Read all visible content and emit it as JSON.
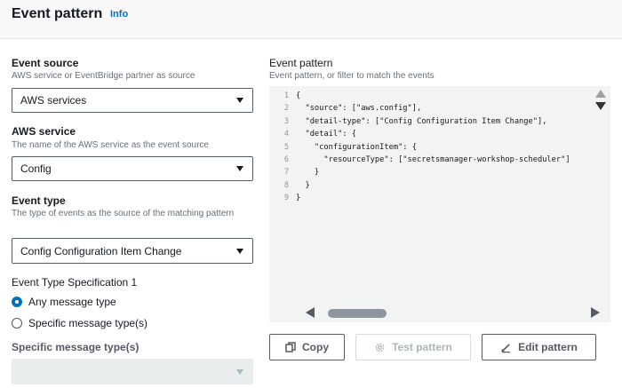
{
  "header": {
    "title": "Event pattern",
    "info": "Info"
  },
  "event_source": {
    "label": "Event source",
    "description": "AWS service or EventBridge partner as source",
    "value": "AWS services"
  },
  "aws_service": {
    "label": "AWS service",
    "description": "The name of the AWS service as the event source",
    "value": "Config"
  },
  "event_type": {
    "label": "Event type",
    "description": "The type of events as the source of the matching pattern",
    "value": "Config Configuration Item Change"
  },
  "spec": {
    "label": "Event Type Specification 1",
    "options": [
      "Any message type",
      "Specific message type(s)"
    ],
    "selected": "Any message type",
    "specific_label": "Specific message type(s)",
    "specific_value": ""
  },
  "pattern": {
    "label": "Event pattern",
    "description": "Event pattern, or filter to match the events",
    "line_numbers": [
      "1",
      "2",
      "3",
      "4",
      "5",
      "6",
      "7",
      "8",
      "9"
    ],
    "lines": [
      "{",
      "  \"source\": [\"aws.config\"],",
      "  \"detail-type\": [\"Config Configuration Item Change\"],",
      "  \"detail\": {",
      "    \"configurationItem\": {",
      "      \"resourceType\": [\"secretsmanager-workshop-scheduler\"]",
      "    }",
      "  }",
      "}"
    ]
  },
  "buttons": {
    "copy": "Copy",
    "test": "Test pattern",
    "edit": "Edit pattern"
  },
  "colors": {
    "accent": "#0073bb",
    "text": "#16191f",
    "muted": "#687078",
    "editor_bg": "#f2f3f3"
  }
}
